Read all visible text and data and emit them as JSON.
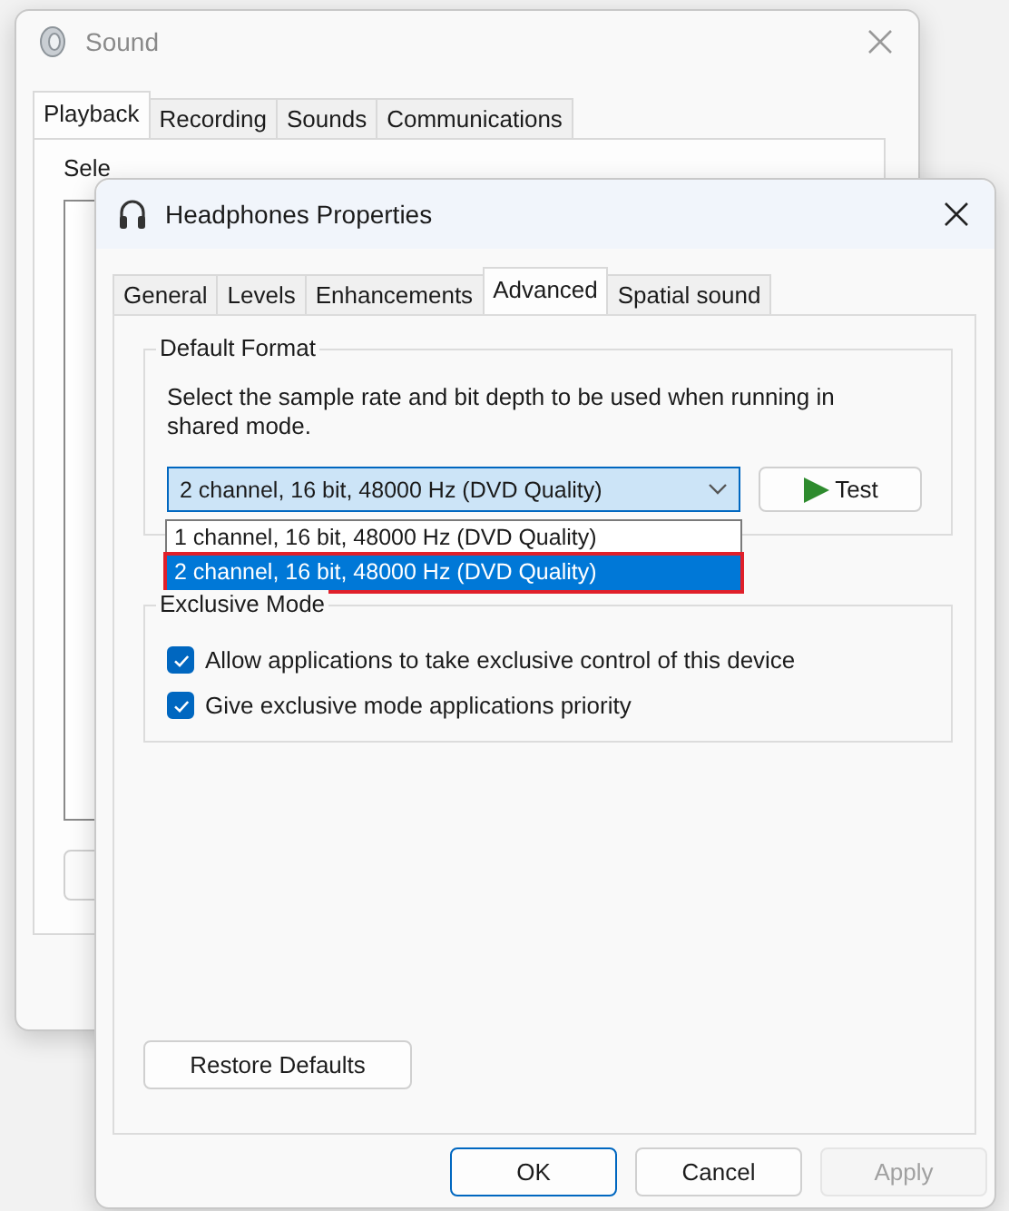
{
  "background_window": {
    "title": "Sound",
    "active": false,
    "tabs": [
      {
        "label": "Playback",
        "selected": true
      },
      {
        "label": "Recording",
        "selected": false
      },
      {
        "label": "Sounds",
        "selected": false
      },
      {
        "label": "Communications",
        "selected": false
      }
    ],
    "instruction": "Sele"
  },
  "dialog": {
    "title": "Headphones Properties",
    "tabs": [
      {
        "label": "General",
        "selected": false
      },
      {
        "label": "Levels",
        "selected": false
      },
      {
        "label": "Enhancements",
        "selected": false
      },
      {
        "label": "Advanced",
        "selected": true
      },
      {
        "label": "Spatial sound",
        "selected": false
      }
    ],
    "default_format": {
      "heading": "Default Format",
      "description": "Select the sample rate and bit depth to be used when running in shared mode.",
      "dropdown": {
        "value": "2 channel, 16 bit, 48000 Hz (DVD Quality)",
        "expanded": true,
        "options": [
          {
            "label": "1 channel, 16 bit, 48000 Hz (DVD Quality)",
            "selected": false,
            "highlighted": false
          },
          {
            "label": "2 channel, 16 bit, 48000 Hz (DVD Quality)",
            "selected": true,
            "highlighted": true
          }
        ]
      },
      "test_button": "Test"
    },
    "exclusive_mode": {
      "heading": "Exclusive Mode",
      "options": [
        {
          "label": "Allow applications to take exclusive control of this device",
          "checked": true
        },
        {
          "label": "Give exclusive mode applications priority",
          "checked": true
        }
      ]
    },
    "restore_button": "Restore Defaults",
    "buttons": [
      {
        "label": "OK",
        "default": true,
        "disabled": false
      },
      {
        "label": "Cancel",
        "default": false,
        "disabled": false
      },
      {
        "label": "Apply",
        "default": false,
        "disabled": true
      }
    ]
  }
}
